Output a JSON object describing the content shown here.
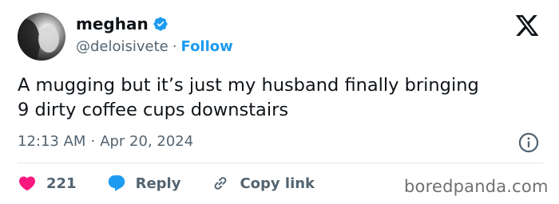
{
  "author": {
    "display_name": "meghan",
    "handle": "@deloisivete",
    "separator": "·",
    "follow_label": "Follow"
  },
  "tweet": {
    "text": "A mugging but it’s just my husband finally bringing\n9 dirty coffee cups downstairs",
    "time": "12:13 AM",
    "meta_separator": "·",
    "date": "Apr 20, 2024"
  },
  "actions": {
    "likes_count": "221",
    "reply_label": "Reply",
    "copy_link_label": "Copy link"
  },
  "watermark": "boredpanda.com",
  "icons": {
    "verified": "verified-badge-icon",
    "x_logo": "x-logo-icon",
    "info": "info-icon",
    "like": "heart-icon",
    "reply": "speech-bubble-icon",
    "copy_link": "link-icon"
  },
  "colors": {
    "accent": "#1d9bf0",
    "like": "#f91880",
    "muted": "#536471",
    "text": "#0f1419"
  }
}
